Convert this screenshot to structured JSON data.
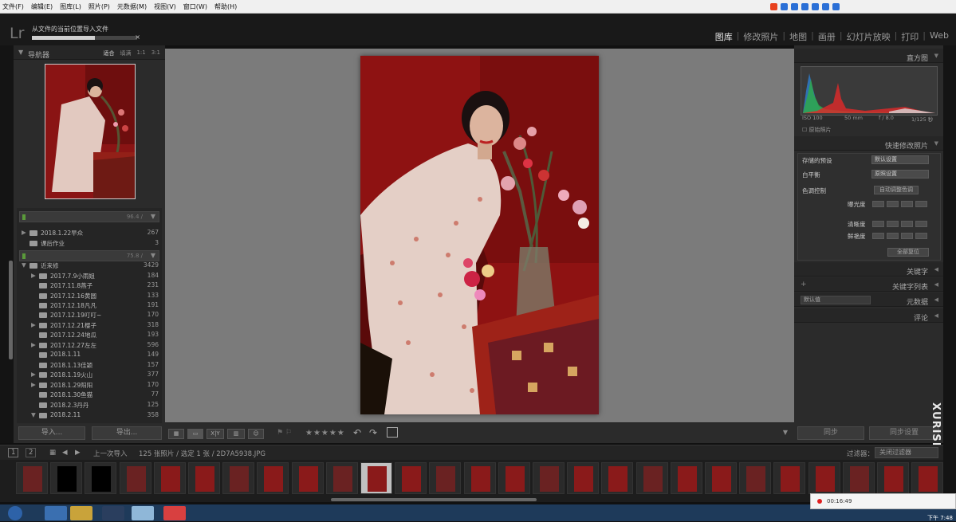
{
  "menubar": {
    "items": [
      "文件(F)",
      "编辑(E)",
      "图库(L)",
      "照片(P)",
      "元数据(M)",
      "视图(V)",
      "窗口(W)",
      "帮助(H)"
    ]
  },
  "topbar": {
    "logo": "Lr",
    "import_label": "从文件的当前位置导入文件",
    "progress": 0.6,
    "close": "×"
  },
  "modules": [
    {
      "label": "图库",
      "active": true
    },
    {
      "label": "修改照片",
      "active": false
    },
    {
      "label": "地图",
      "active": false
    },
    {
      "label": "画册",
      "active": false
    },
    {
      "label": "幻灯片放映",
      "active": false
    },
    {
      "label": "打印",
      "active": false
    },
    {
      "label": "Web",
      "active": false
    }
  ],
  "navigator": {
    "title": "导航器",
    "zooms": [
      "适合",
      "填满",
      "1:1",
      "3:1"
    ]
  },
  "folders": [
    {
      "name": "2018.1.22早众",
      "count": "267",
      "level": 1,
      "expander": "▶"
    },
    {
      "name": "课后作业",
      "count": "3",
      "level": 1,
      "expander": ""
    },
    {
      "name": "近来修",
      "count": "3429",
      "level": 1,
      "expander": "▼"
    },
    {
      "name": "2017.7.9小雨姐",
      "count": "184",
      "level": 2,
      "expander": "▶"
    },
    {
      "name": "2017.11.8燕子",
      "count": "231",
      "level": 2,
      "expander": ""
    },
    {
      "name": "2017.12.16黄圆",
      "count": "133",
      "level": 2,
      "expander": ""
    },
    {
      "name": "2017.12.18凡凡",
      "count": "191",
      "level": 2,
      "expander": ""
    },
    {
      "name": "2017.12.19叮叮~",
      "count": "170",
      "level": 2,
      "expander": ""
    },
    {
      "name": "2017.12.21樱子",
      "count": "318",
      "level": 2,
      "expander": "▶"
    },
    {
      "name": "2017.12.24地瓜",
      "count": "193",
      "level": 2,
      "expander": ""
    },
    {
      "name": "2017.12.27左左",
      "count": "596",
      "level": 2,
      "expander": "▶"
    },
    {
      "name": "2018.1.11",
      "count": "149",
      "level": 2,
      "expander": ""
    },
    {
      "name": "2018.1.13佳颖",
      "count": "157",
      "level": 2,
      "expander": ""
    },
    {
      "name": "2018.1.19火山",
      "count": "377",
      "level": 2,
      "expander": "▶"
    },
    {
      "name": "2018.1.29阳阳",
      "count": "170",
      "level": 2,
      "expander": "▶"
    },
    {
      "name": "2018.1.30鱼猫",
      "count": "77",
      "level": 2,
      "expander": ""
    },
    {
      "name": "2018.2.3丹丹",
      "count": "125",
      "level": 2,
      "expander": ""
    },
    {
      "name": "2018.2.11",
      "count": "358",
      "level": 2,
      "expander": "▼"
    }
  ],
  "volumes": [
    {
      "label": "96.4 /"
    },
    {
      "label": "75.8 /"
    }
  ],
  "left_buttons": {
    "import": "导入...",
    "export": "导出..."
  },
  "toolbar": {
    "stars": "★★★★★",
    "view_xy": "X|Y"
  },
  "right": {
    "histogram": "直方图",
    "exif": {
      "iso": "ISO 100",
      "focal": "50 mm",
      "aperture": "f / 8.0",
      "shutter": "1/125 秒"
    },
    "original_photo": "原始照片",
    "quick_develop": "快速修改照片",
    "saved_preset": "存储的预设",
    "saved_preset_value": "默认设置",
    "white_balance": "白平衡",
    "white_balance_value": "原照设置",
    "tone_control": "色调控制",
    "auto_tone": "自动调整色调",
    "exposure": "曝光度",
    "clarity": "清晰度",
    "vibrance": "鲜艳度",
    "reset_all": "全部复位",
    "keywording": "关键字",
    "keyword_list": "关键字列表",
    "metadata": "元数据",
    "metadata_preset": "默认值",
    "comments": "评论",
    "sync": "同步",
    "sync_settings": "同步设置"
  },
  "filmbar": {
    "page1": "1",
    "page2": "2",
    "source": "上一次导入",
    "info": "125 张照片 / 选定 1 张 / 2D7A5938.JPG",
    "filter_label": "过滤器：",
    "filter_value": "关闭过滤器"
  },
  "watermark": "XURISN.COM",
  "notification": "00:16:49",
  "clock": "下午 7:48"
}
